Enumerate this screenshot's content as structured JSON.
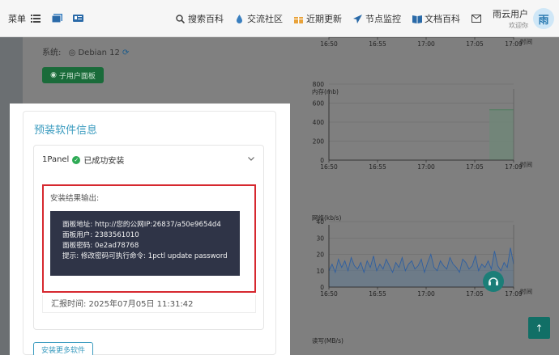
{
  "topbar": {
    "menu_label": "菜单",
    "nav": [
      {
        "label": "搜索百科",
        "icon": "search-icon"
      },
      {
        "label": "交流社区",
        "icon": "drop-icon"
      },
      {
        "label": "近期更新",
        "icon": "gift-icon"
      },
      {
        "label": "节点监控",
        "icon": "send-icon"
      },
      {
        "label": "文档百科",
        "icon": "book-icon"
      }
    ],
    "mail_icon": "mail-icon",
    "user_name": "雨云用户",
    "user_role": "欢迎你",
    "avatar_text": "雨"
  },
  "server": {
    "system_label": "系统:",
    "system_value": "Debian 12",
    "sub_panel_button": "子用户面板"
  },
  "install_card": {
    "title": "预装软件信息",
    "software_name": "1Panel",
    "status": "已成功安装",
    "output_label": "安装结果输出:",
    "output_lines": [
      "面板地址: http://您的公网IP:26837/a50e9654d4",
      "面板用户: 2383561010",
      "面板密码: 0e2ad78768",
      "提示: 修改密码可执行命令: 1pctl update password"
    ],
    "report_time": "汇报时间:  2025年07月05日  11:31:42",
    "install_more_button": "安装更多软件"
  },
  "colors": {
    "accent": "#3a9bbf",
    "success": "#2eaa55",
    "highlight_border": "#d6282f",
    "terminal_bg": "#2f3447"
  },
  "chart_data": [
    {
      "type": "line",
      "title": "",
      "x": [
        "16:50",
        "16:55",
        "17:00",
        "17:05",
        "17:09"
      ],
      "xlabel": "时间",
      "partial": true
    },
    {
      "type": "area",
      "title": "内存(mb)",
      "x": [
        "16:50",
        "16:55",
        "17:00",
        "17:05",
        "17:09"
      ],
      "xlabel": "时间",
      "yticks": [
        0,
        200,
        400,
        600,
        800
      ],
      "ylim": [
        0,
        800
      ],
      "series": [
        {
          "values_desc": "flat",
          "start_minute": 16.5,
          "end_minute": 19,
          "value": 530
        }
      ]
    },
    {
      "type": "line",
      "title": "网络(kb/s)",
      "x": [
        "16:50",
        "16:55",
        "17:00",
        "17:05",
        "17:09"
      ],
      "xlabel": "时间",
      "yticks": [
        0,
        10,
        20,
        30,
        40
      ],
      "ylim": [
        0,
        40
      ],
      "series": [
        {
          "values": [
            10,
            14,
            9,
            17,
            12,
            16,
            10,
            18,
            13,
            11,
            15,
            9,
            16,
            12,
            19,
            10,
            14,
            11,
            17,
            13,
            9,
            15,
            12,
            18,
            10,
            14,
            16,
            11,
            13,
            17,
            9,
            15,
            20,
            12,
            10,
            16,
            13,
            11,
            18,
            14,
            12,
            9,
            17,
            15,
            11,
            13,
            19,
            10,
            14,
            12,
            16,
            11,
            22,
            13,
            10,
            15,
            12,
            24,
            14
          ]
        }
      ]
    },
    {
      "type": "line",
      "title": "读写(MB/s)",
      "partial": true
    }
  ]
}
